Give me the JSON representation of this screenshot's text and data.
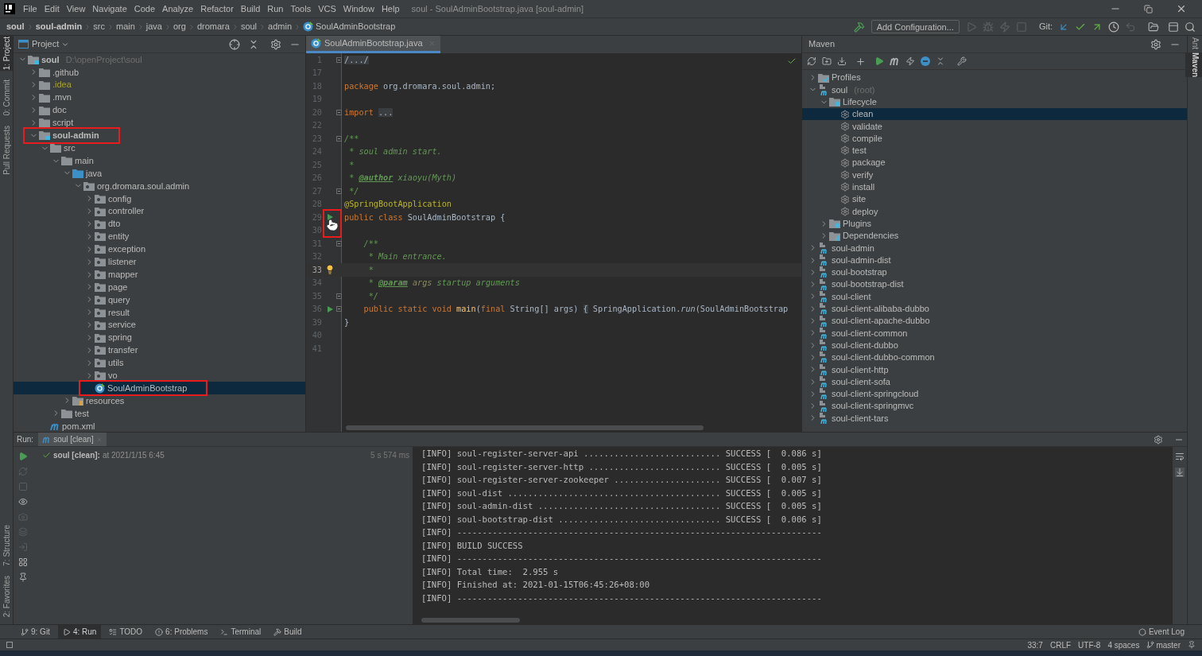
{
  "menu_bar": {
    "items": [
      "File",
      "Edit",
      "View",
      "Navigate",
      "Code",
      "Analyze",
      "Refactor",
      "Build",
      "Run",
      "Tools",
      "VCS",
      "Window",
      "Help"
    ],
    "title": "soul - SoulAdminBootstrap.java [soul-admin]"
  },
  "breadcrumbs": [
    {
      "label": "soul",
      "kind": "module"
    },
    {
      "label": "soul-admin",
      "kind": "module"
    },
    {
      "label": "src",
      "kind": "folder"
    },
    {
      "label": "main",
      "kind": "folder"
    },
    {
      "label": "java",
      "kind": "folder"
    },
    {
      "label": "org",
      "kind": "folder"
    },
    {
      "label": "dromara",
      "kind": "folder"
    },
    {
      "label": "soul",
      "kind": "folder"
    },
    {
      "label": "admin",
      "kind": "folder"
    },
    {
      "label": "SoulAdminBootstrap",
      "kind": "class"
    }
  ],
  "toolbar": {
    "run_config": "Add Configuration...",
    "git_label": "Git:"
  },
  "left_stripe": {
    "top": [
      {
        "label": "1: Project",
        "selected": true
      },
      {
        "label": "0: Commit",
        "selected": false
      },
      {
        "label": "Pull Requests",
        "selected": false
      }
    ],
    "bottom": [
      {
        "label": "7: Structure",
        "selected": false
      },
      {
        "label": "2: Favorites",
        "selected": false
      }
    ]
  },
  "project": {
    "title": "Project",
    "tree": [
      {
        "label": "soul",
        "kind": "module",
        "hint": "D:\\openProject\\soul",
        "expanded": true,
        "selected": false,
        "marked": false,
        "children": [
          {
            "label": ".github",
            "kind": "folder",
            "expanded": false,
            "selected": false,
            "marked": false
          },
          {
            "label": ".idea",
            "kind": "folder",
            "color": "#a8a335",
            "expanded": false,
            "selected": false,
            "marked": false
          },
          {
            "label": ".mvn",
            "kind": "folder",
            "expanded": false,
            "selected": false,
            "marked": false
          },
          {
            "label": "doc",
            "kind": "folder",
            "expanded": false,
            "selected": false,
            "marked": false
          },
          {
            "label": "script",
            "kind": "folder",
            "expanded": false,
            "selected": false,
            "marked": false
          },
          {
            "label": "soul-admin",
            "kind": "module",
            "expanded": true,
            "selected": false,
            "marked": true,
            "children": [
              {
                "label": "src",
                "kind": "folder",
                "expanded": true,
                "selected": false,
                "marked": false,
                "children": [
                  {
                    "label": "main",
                    "kind": "folder",
                    "expanded": true,
                    "selected": false,
                    "marked": false,
                    "children": [
                      {
                        "label": "java",
                        "kind": "source-root",
                        "expanded": true,
                        "selected": false,
                        "marked": false,
                        "children": [
                          {
                            "label": "org.dromara.soul.admin",
                            "kind": "package",
                            "expanded": true,
                            "selected": false,
                            "marked": false,
                            "children": [
                              {
                                "label": "config",
                                "kind": "package",
                                "expanded": false,
                                "selected": false,
                                "marked": false
                              },
                              {
                                "label": "controller",
                                "kind": "package",
                                "expanded": false,
                                "selected": false,
                                "marked": false
                              },
                              {
                                "label": "dto",
                                "kind": "package",
                                "expanded": false,
                                "selected": false,
                                "marked": false
                              },
                              {
                                "label": "entity",
                                "kind": "package",
                                "expanded": false,
                                "selected": false,
                                "marked": false
                              },
                              {
                                "label": "exception",
                                "kind": "package",
                                "expanded": false,
                                "selected": false,
                                "marked": false
                              },
                              {
                                "label": "listener",
                                "kind": "package",
                                "expanded": false,
                                "selected": false,
                                "marked": false
                              },
                              {
                                "label": "mapper",
                                "kind": "package",
                                "expanded": false,
                                "selected": false,
                                "marked": false
                              },
                              {
                                "label": "page",
                                "kind": "package",
                                "expanded": false,
                                "selected": false,
                                "marked": false
                              },
                              {
                                "label": "query",
                                "kind": "package",
                                "expanded": false,
                                "selected": false,
                                "marked": false
                              },
                              {
                                "label": "result",
                                "kind": "package",
                                "expanded": false,
                                "selected": false,
                                "marked": false
                              },
                              {
                                "label": "service",
                                "kind": "package",
                                "expanded": false,
                                "selected": false,
                                "marked": false
                              },
                              {
                                "label": "spring",
                                "kind": "package",
                                "expanded": false,
                                "selected": false,
                                "marked": false
                              },
                              {
                                "label": "transfer",
                                "kind": "package",
                                "expanded": false,
                                "selected": false,
                                "marked": false
                              },
                              {
                                "label": "utils",
                                "kind": "package",
                                "expanded": false,
                                "selected": false,
                                "marked": false
                              },
                              {
                                "label": "vo",
                                "kind": "package",
                                "expanded": false,
                                "selected": false,
                                "marked": false
                              },
                              {
                                "label": "SoulAdminBootstrap",
                                "kind": "class",
                                "selected": true,
                                "marked": true
                              }
                            ]
                          }
                        ]
                      },
                      {
                        "label": "resources",
                        "kind": "resources",
                        "expanded": false,
                        "selected": false,
                        "marked": false
                      }
                    ]
                  },
                  {
                    "label": "test",
                    "kind": "folder",
                    "expanded": false,
                    "selected": false,
                    "marked": false
                  }
                ]
              },
              {
                "label": "pom.xml",
                "kind": "maven-file",
                "selected": false,
                "marked": false
              }
            ]
          }
        ]
      }
    ]
  },
  "editor": {
    "tabs": [
      {
        "label": "SoulAdminBootstrap.java",
        "selected": true
      }
    ],
    "lines": [
      {
        "number": "1",
        "run": false,
        "fold": true,
        "bulb": false,
        "current": false,
        "marked": false,
        "tokens": [
          {
            "t": "/.../",
            "kind": "folded"
          }
        ]
      },
      {
        "number": "17",
        "run": false,
        "fold": false,
        "bulb": false,
        "current": false,
        "marked": false
      },
      {
        "number": "18",
        "run": false,
        "fold": false,
        "bulb": false,
        "current": false,
        "marked": false,
        "tokens": [
          {
            "t": "package",
            "kind": "keyword"
          },
          {
            "t": " org.dromara.soul.admin;",
            "kind": "plain"
          }
        ]
      },
      {
        "number": "19",
        "run": false,
        "fold": false,
        "bulb": false,
        "current": false,
        "marked": false
      },
      {
        "number": "20",
        "run": false,
        "fold": true,
        "bulb": false,
        "current": false,
        "marked": false,
        "tokens": [
          {
            "t": "import ",
            "kind": "keyword"
          },
          {
            "t": "...",
            "kind": "folded"
          }
        ]
      },
      {
        "number": "22",
        "run": false,
        "fold": false,
        "bulb": false,
        "current": false,
        "marked": false
      },
      {
        "number": "23",
        "run": false,
        "fold": true,
        "bulb": false,
        "current": false,
        "marked": false,
        "tokens": [
          {
            "t": "/**",
            "kind": "doc"
          }
        ]
      },
      {
        "number": "24",
        "run": false,
        "fold": false,
        "bulb": false,
        "current": false,
        "marked": false,
        "tokens": [
          {
            "t": " * soul admin start.",
            "kind": "doc"
          }
        ]
      },
      {
        "number": "25",
        "run": false,
        "fold": false,
        "bulb": false,
        "current": false,
        "marked": false,
        "tokens": [
          {
            "t": " *",
            "kind": "doc"
          }
        ]
      },
      {
        "number": "26",
        "run": false,
        "fold": false,
        "bulb": false,
        "current": false,
        "marked": false,
        "tokens": [
          {
            "t": " * ",
            "kind": "doc"
          },
          {
            "t": "@author",
            "kind": "doc-tag"
          },
          {
            "t": " xiaoyu(Myth)",
            "kind": "doc"
          }
        ]
      },
      {
        "number": "27",
        "run": false,
        "fold": true,
        "bulb": false,
        "current": false,
        "marked": false,
        "tokens": [
          {
            "t": " */",
            "kind": "doc"
          }
        ]
      },
      {
        "number": "28",
        "run": false,
        "fold": false,
        "bulb": false,
        "current": false,
        "marked": false,
        "tokens": [
          {
            "t": "@SpringBootApplication",
            "kind": "annotation"
          }
        ]
      },
      {
        "number": "29",
        "run": true,
        "fold": false,
        "bulb": false,
        "current": false,
        "marked": true,
        "tokens": [
          {
            "t": "public class ",
            "kind": "keyword"
          },
          {
            "t": "SoulAdminBootstrap {",
            "kind": "plain"
          }
        ]
      },
      {
        "number": "30",
        "run": false,
        "fold": false,
        "bulb": false,
        "current": false,
        "marked": false
      },
      {
        "number": "31",
        "run": false,
        "fold": true,
        "bulb": false,
        "current": false,
        "marked": false,
        "tokens": [
          {
            "t": "    /**",
            "kind": "doc"
          }
        ]
      },
      {
        "number": "32",
        "run": false,
        "fold": false,
        "bulb": false,
        "current": false,
        "marked": false,
        "tokens": [
          {
            "t": "     * Main entrance.",
            "kind": "doc"
          }
        ]
      },
      {
        "number": "33",
        "run": false,
        "fold": false,
        "bulb": true,
        "current": true,
        "marked": false,
        "tokens": [
          {
            "t": "     *",
            "kind": "doc"
          }
        ]
      },
      {
        "number": "34",
        "run": false,
        "fold": false,
        "bulb": false,
        "current": false,
        "marked": false,
        "tokens": [
          {
            "t": "     * ",
            "kind": "doc"
          },
          {
            "t": "@param",
            "kind": "doc-tag"
          },
          {
            "t": " args",
            "kind": "doc-param"
          },
          {
            "t": " startup arguments",
            "kind": "doc"
          }
        ]
      },
      {
        "number": "35",
        "run": false,
        "fold": true,
        "bulb": false,
        "current": false,
        "marked": false,
        "tokens": [
          {
            "t": "     */",
            "kind": "doc"
          }
        ]
      },
      {
        "number": "36",
        "run": true,
        "fold": true,
        "bulb": false,
        "current": false,
        "marked": false,
        "tokens": [
          {
            "t": "    public static void ",
            "kind": "keyword"
          },
          {
            "t": "main",
            "kind": "method"
          },
          {
            "t": "(",
            "kind": "plain"
          },
          {
            "t": "final ",
            "kind": "keyword"
          },
          {
            "t": "String[] args) ",
            "kind": "plain"
          },
          {
            "t": "{",
            "kind": "folded"
          },
          {
            "t": " SpringApplication.",
            "kind": "plain"
          },
          {
            "t": "run",
            "kind": "static"
          },
          {
            "t": "(SoulAdminBootstrap",
            "kind": "plain"
          }
        ]
      },
      {
        "number": "39",
        "run": false,
        "fold": false,
        "bulb": false,
        "current": false,
        "marked": false,
        "tokens": [
          {
            "t": "}",
            "kind": "plain"
          }
        ]
      },
      {
        "number": "40",
        "run": false,
        "fold": false,
        "bulb": false,
        "current": false,
        "marked": false
      },
      {
        "number": "41",
        "run": false,
        "fold": false,
        "bulb": false,
        "current": false,
        "marked": false
      }
    ]
  },
  "maven": {
    "title": "Maven",
    "tree": [
      {
        "label": "Profiles",
        "kind": "profiles",
        "expanded": false,
        "selected": false,
        "marked": false
      },
      {
        "label": "soul",
        "kind": "maven-module",
        "hint": "(root)",
        "expanded": true,
        "selected": false,
        "marked": false,
        "children": [
          {
            "label": "Lifecycle",
            "kind": "lifecycle",
            "expanded": true,
            "selected": false,
            "marked": false,
            "children": [
              {
                "label": "clean",
                "kind": "goal",
                "selected": true,
                "marked": false
              },
              {
                "label": "validate",
                "kind": "goal",
                "selected": false,
                "marked": false
              },
              {
                "label": "compile",
                "kind": "goal",
                "selected": false,
                "marked": false
              },
              {
                "label": "test",
                "kind": "goal",
                "selected": false,
                "marked": false
              },
              {
                "label": "package",
                "kind": "goal",
                "selected": false,
                "marked": false
              },
              {
                "label": "verify",
                "kind": "goal",
                "selected": false,
                "marked": false
              },
              {
                "label": "install",
                "kind": "goal",
                "selected": false,
                "marked": false
              },
              {
                "label": "site",
                "kind": "goal",
                "selected": false,
                "marked": false
              },
              {
                "label": "deploy",
                "kind": "goal",
                "selected": false,
                "marked": false
              }
            ]
          },
          {
            "label": "Plugins",
            "kind": "lifecycle",
            "expanded": false,
            "selected": false,
            "marked": false
          },
          {
            "label": "Dependencies",
            "kind": "dependencies",
            "expanded": false,
            "selected": false,
            "marked": false
          }
        ]
      },
      {
        "label": "soul-admin",
        "kind": "maven-module",
        "expanded": false,
        "selected": false,
        "marked": false
      },
      {
        "label": "soul-admin-dist",
        "kind": "maven-module",
        "expanded": false,
        "selected": false,
        "marked": false
      },
      {
        "label": "soul-bootstrap",
        "kind": "maven-module",
        "expanded": false,
        "selected": false,
        "marked": false
      },
      {
        "label": "soul-bootstrap-dist",
        "kind": "maven-module",
        "expanded": false,
        "selected": false,
        "marked": false
      },
      {
        "label": "soul-client",
        "kind": "maven-module",
        "expanded": false,
        "selected": false,
        "marked": false
      },
      {
        "label": "soul-client-alibaba-dubbo",
        "kind": "maven-module",
        "expanded": false,
        "selected": false,
        "marked": false
      },
      {
        "label": "soul-client-apache-dubbo",
        "kind": "maven-module",
        "expanded": false,
        "selected": false,
        "marked": false
      },
      {
        "label": "soul-client-common",
        "kind": "maven-module",
        "expanded": false,
        "selected": false,
        "marked": false
      },
      {
        "label": "soul-client-dubbo",
        "kind": "maven-module",
        "expanded": false,
        "selected": false,
        "marked": false
      },
      {
        "label": "soul-client-dubbo-common",
        "kind": "maven-module",
        "expanded": false,
        "selected": false,
        "marked": false
      },
      {
        "label": "soul-client-http",
        "kind": "maven-module",
        "expanded": false,
        "selected": false,
        "marked": false
      },
      {
        "label": "soul-client-sofa",
        "kind": "maven-module",
        "expanded": false,
        "selected": false,
        "marked": false
      },
      {
        "label": "soul-client-springcloud",
        "kind": "maven-module",
        "expanded": false,
        "selected": false,
        "marked": false
      },
      {
        "label": "soul-client-springmvc",
        "kind": "maven-module",
        "expanded": false,
        "selected": false,
        "marked": false
      },
      {
        "label": "soul-client-tars",
        "kind": "maven-module",
        "expanded": false,
        "selected": false,
        "marked": false
      }
    ]
  },
  "right_stripe": [
    {
      "label": "Ant",
      "selected": false
    },
    {
      "label": "Maven",
      "selected": true
    }
  ],
  "run": {
    "title": "Run:",
    "tabs": [
      {
        "label": "soul [clean]",
        "selected": true
      }
    ],
    "tree": [
      {
        "label": "soul [clean]:",
        "detail": "at 2021/1/15 6:45",
        "time": "5 s 574 ms",
        "succeeded": true
      }
    ],
    "console": [
      "[INFO] soul-register-server-api ........................... SUCCESS [  0.086 s]",
      "[INFO] soul-register-server-http .......................... SUCCESS [  0.005 s]",
      "[INFO] soul-register-server-zookeeper ..................... SUCCESS [  0.007 s]",
      "[INFO] soul-dist .......................................... SUCCESS [  0.005 s]",
      "[INFO] soul-admin-dist .................................... SUCCESS [  0.005 s]",
      "[INFO] soul-bootstrap-dist ................................ SUCCESS [  0.006 s]",
      "[INFO] ------------------------------------------------------------------------",
      "[INFO] BUILD SUCCESS",
      "[INFO] ------------------------------------------------------------------------",
      "[INFO] Total time:  2.955 s",
      "[INFO] Finished at: 2021-01-15T06:45:26+08:00",
      "[INFO] ------------------------------------------------------------------------"
    ]
  },
  "tool_tabs": [
    {
      "label": "9: Git",
      "kind": "git",
      "selected": false
    },
    {
      "label": "4: Run",
      "kind": "run",
      "selected": true
    },
    {
      "label": "TODO",
      "kind": "todo",
      "selected": false
    },
    {
      "label": "6: Problems",
      "kind": "problems",
      "selected": false
    },
    {
      "label": "Terminal",
      "kind": "terminal",
      "selected": false
    },
    {
      "label": "Build",
      "kind": "build",
      "selected": false
    }
  ],
  "event_log": "Event Log",
  "status_bar": [
    {
      "label": "33:7",
      "kind": "text"
    },
    {
      "label": "CRLF",
      "kind": "text"
    },
    {
      "label": "UTF-8",
      "kind": "text"
    },
    {
      "label": "4 spaces",
      "kind": "text"
    },
    {
      "label": "master",
      "kind": "branch"
    }
  ]
}
